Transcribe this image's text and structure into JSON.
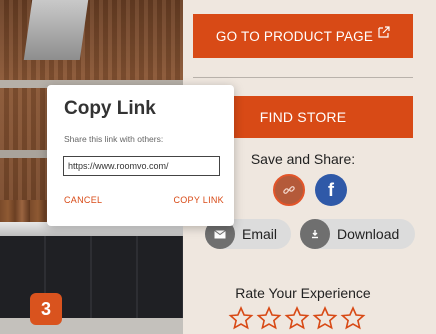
{
  "badge": {
    "number": "3"
  },
  "buttons": {
    "go_to_product": "GO TO PRODUCT PAGE",
    "find_store": "FIND STORE"
  },
  "share": {
    "title": "Save and Share:",
    "email_label": "Email",
    "download_label": "Download",
    "facebook_glyph": "f"
  },
  "rating": {
    "title": "Rate Your Experience",
    "stars_total": 5
  },
  "copy_link_modal": {
    "title": "Copy Link",
    "subtitle": "Share this link with others:",
    "url_value": "https://www.roomvo.com/",
    "cancel_label": "CANCEL",
    "copy_label": "COPY LINK"
  },
  "icons": {
    "external": "external-link-icon",
    "link": "link-icon",
    "facebook": "facebook-icon",
    "email": "email-icon",
    "download": "download-icon",
    "star": "star-outline-icon"
  },
  "colors": {
    "accent": "#d84a16",
    "facebook": "#2f59a8",
    "panel_bg": "#efe7df"
  }
}
